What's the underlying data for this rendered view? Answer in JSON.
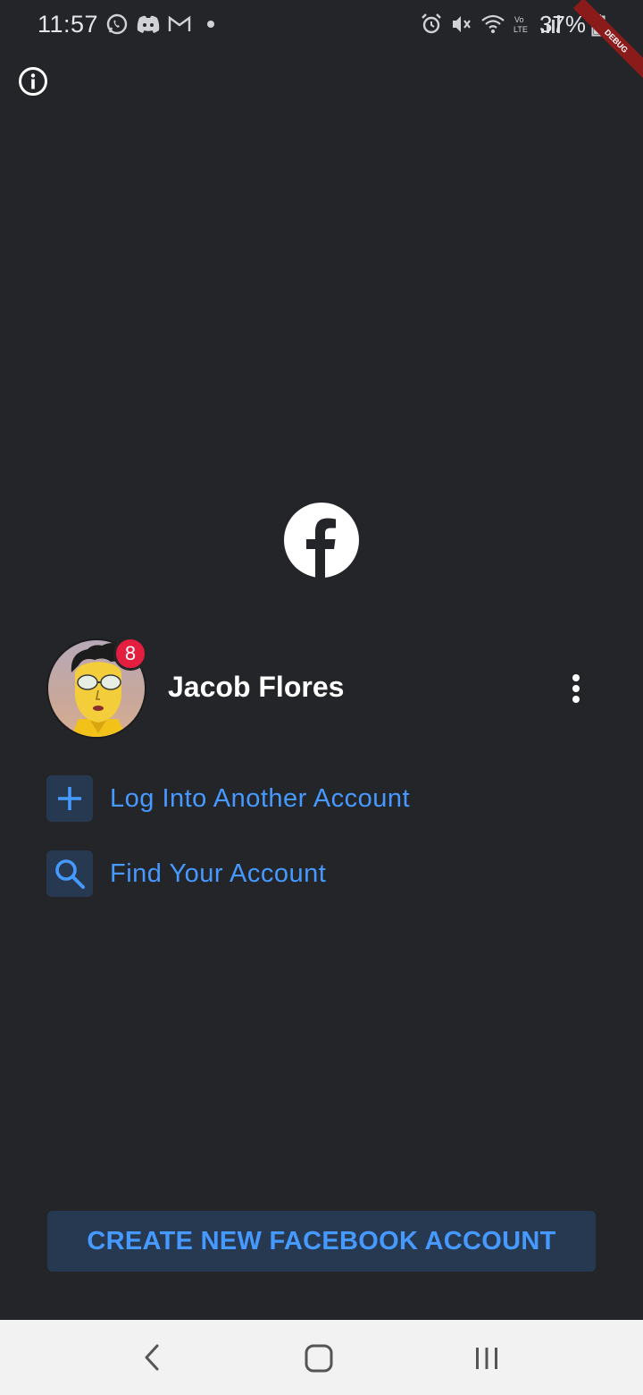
{
  "status_bar": {
    "time": "11:57",
    "battery": "37%",
    "left_icons": [
      "whatsapp-icon",
      "discord-icon",
      "gmail-icon",
      "dot-icon"
    ],
    "right_icons": [
      "alarm-icon",
      "mute-icon",
      "wifi-icon",
      "volte-icon",
      "signal-icon",
      "battery-icon"
    ]
  },
  "debug_banner": "DEBUG",
  "account": {
    "name": "Jacob Flores",
    "notification_count": "8"
  },
  "actions": {
    "login_another": "Log Into Another Account",
    "find_account": "Find Your Account"
  },
  "create_account_label": "CREATE NEW FACEBOOK ACCOUNT",
  "colors": {
    "background": "#242528",
    "accent": "#4599ff",
    "button_bg": "#263951",
    "badge": "#e41e3f"
  }
}
